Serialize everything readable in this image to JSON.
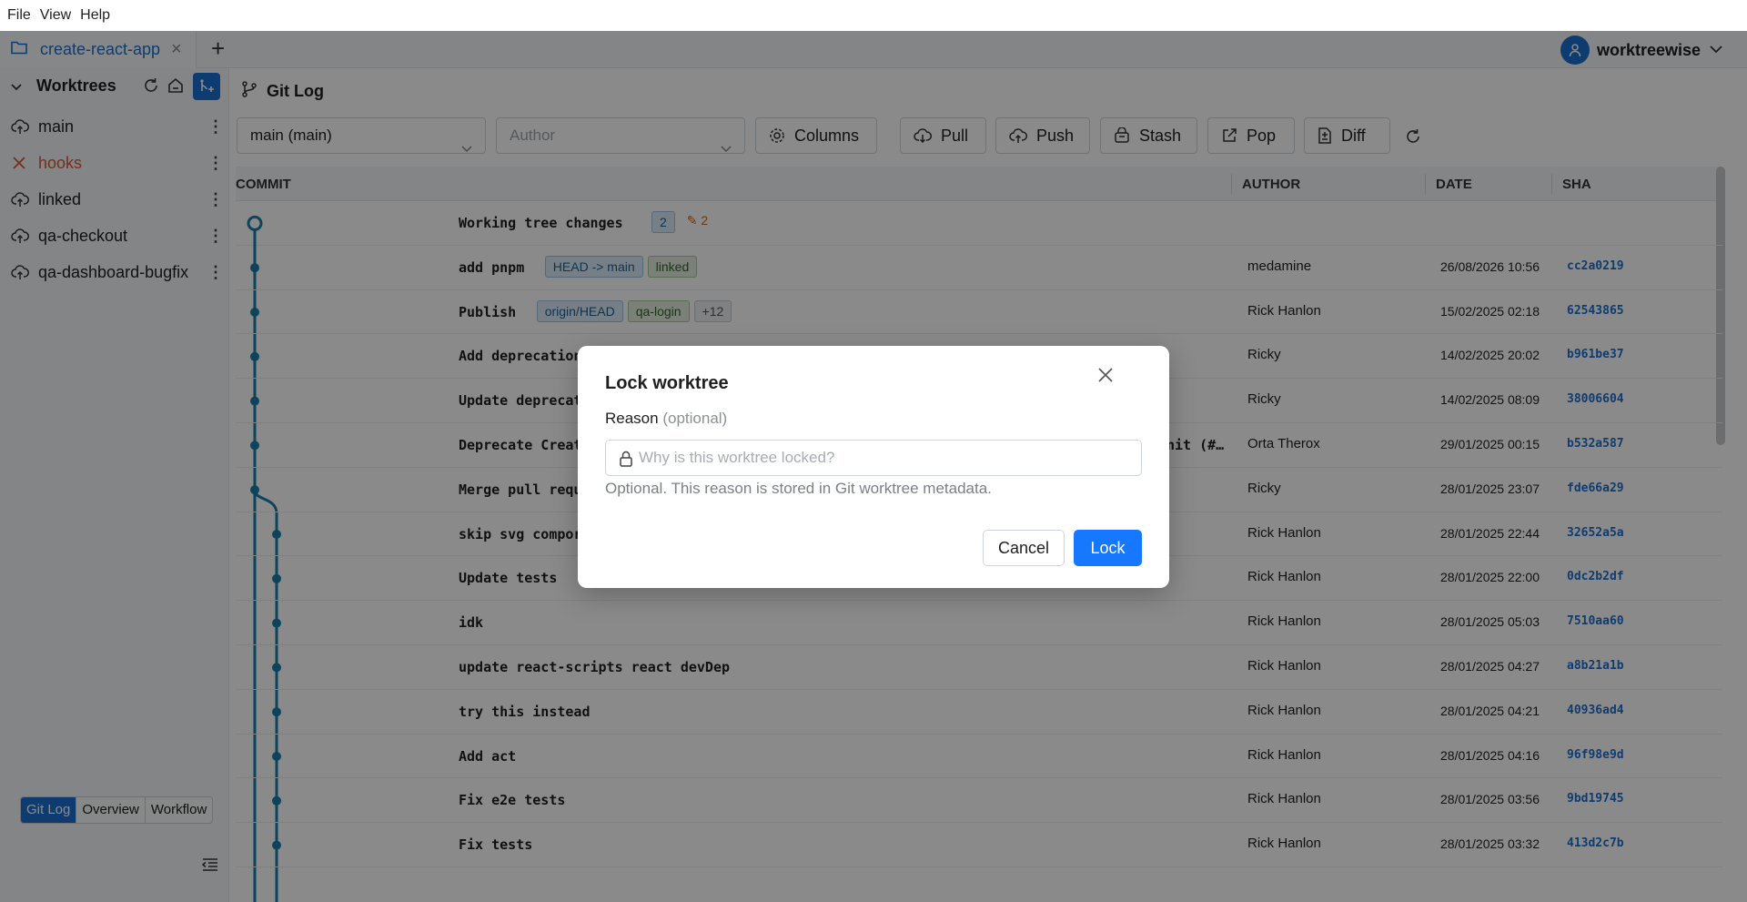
{
  "menu": [
    "File",
    "View",
    "Help"
  ],
  "tabs": {
    "project": "create-react-app",
    "user": "worktreewise"
  },
  "sidebar": {
    "title": "Worktrees",
    "items": [
      {
        "label": "main",
        "status": "cloud"
      },
      {
        "label": "hooks",
        "status": "locked"
      },
      {
        "label": "linked",
        "status": "cloud"
      },
      {
        "label": "qa-checkout",
        "status": "cloud"
      },
      {
        "label": "qa-dashboard-bugfix",
        "status": "cloud"
      }
    ],
    "view_tabs": [
      "Git Log",
      "Overview",
      "Workflow"
    ],
    "active_view": "Git Log"
  },
  "gitlog": {
    "title": "Git Log",
    "branch_select": "main (main)",
    "author_placeholder": "Author",
    "buttons": [
      "Columns",
      "Pull",
      "Push",
      "Stash",
      "Pop",
      "Diff"
    ],
    "columns": [
      "COMMIT",
      "AUTHOR",
      "DATE",
      "SHA"
    ],
    "working_tree": {
      "label": "Working tree changes",
      "count": "2",
      "modified": "2"
    },
    "rows": [
      {
        "msg": "add pnpm",
        "badges": [
          {
            "t": "HEAD -> main",
            "c": "blue"
          },
          {
            "t": "linked",
            "c": "green"
          }
        ],
        "author": "medamine",
        "date": "26/08/2026 10:56",
        "sha": "cc2a0219"
      },
      {
        "msg": "Publish",
        "badges": [
          {
            "t": "origin/HEAD",
            "c": "blue"
          },
          {
            "t": "qa-login",
            "c": "green"
          },
          {
            "t": "+12",
            "c": "gray"
          }
        ],
        "author": "Rick Hanlon",
        "date": "15/02/2025 02:18",
        "sha": "62543865"
      },
      {
        "msg": "Add deprecation",
        "badges": [],
        "author": "Ricky",
        "date": "14/02/2025 20:02",
        "sha": "b961be37"
      },
      {
        "msg": "Update deprecat",
        "badges": [],
        "author": "Ricky",
        "date": "14/02/2025 08:09",
        "sha": "38006604"
      },
      {
        "msg": "Deprecate Creat",
        "tail": "nit (#…",
        "badges": [],
        "author": "Orta Therox",
        "date": "29/01/2025 00:15",
        "sha": "b532a587"
      },
      {
        "msg": "Merge pull requ",
        "badges": [],
        "author": "Ricky",
        "date": "28/01/2025 23:07",
        "sha": "fde66a29"
      },
      {
        "msg": "skip svg compor",
        "badges": [],
        "author": "Rick Hanlon",
        "date": "28/01/2025 22:44",
        "sha": "32652a5a"
      },
      {
        "msg": "Update tests",
        "badges": [],
        "author": "Rick Hanlon",
        "date": "28/01/2025 22:00",
        "sha": "0dc2b2df"
      },
      {
        "msg": "idk",
        "badges": [],
        "author": "Rick Hanlon",
        "date": "28/01/2025 05:03",
        "sha": "7510aa60"
      },
      {
        "msg": "update react-scripts react devDep",
        "badges": [],
        "author": "Rick Hanlon",
        "date": "28/01/2025 04:27",
        "sha": "a8b21a1b"
      },
      {
        "msg": "try this instead",
        "badges": [],
        "author": "Rick Hanlon",
        "date": "28/01/2025 04:21",
        "sha": "40936ad4"
      },
      {
        "msg": "Add act",
        "badges": [],
        "author": "Rick Hanlon",
        "date": "28/01/2025 04:16",
        "sha": "96f98e9d"
      },
      {
        "msg": "Fix e2e tests",
        "badges": [],
        "author": "Rick Hanlon",
        "date": "28/01/2025 03:56",
        "sha": "9bd19745"
      },
      {
        "msg": "Fix tests",
        "badges": [],
        "author": "Rick Hanlon",
        "date": "28/01/2025 03:32",
        "sha": "413d2c7b"
      }
    ]
  },
  "modal": {
    "title": "Lock worktree",
    "label": "Reason",
    "label_optional": "(optional)",
    "placeholder": "Why is this worktree locked?",
    "help": "Optional. This reason is stored in Git worktree metadata.",
    "cancel": "Cancel",
    "confirm": "Lock"
  },
  "colors": {
    "accent": "#1a6fd1",
    "graph": "#1b7fa8",
    "lock_button": "#1677ff",
    "locked_text": "#d35a32"
  }
}
